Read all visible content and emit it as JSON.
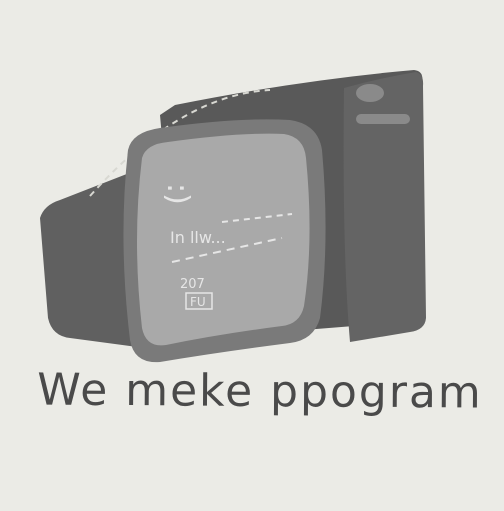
{
  "caption": "We meke ppogram",
  "screen": {
    "smiley": ":)",
    "icon_name": "smiley-face",
    "scribble_text": "In llw...",
    "small_note": "207",
    "boxed_label": "FU"
  },
  "colors": {
    "background": "#ebebe6",
    "monitor_body_dark": "#5a5a5a",
    "monitor_back_dark": "#4f4f4f",
    "monitor_side": "#666666",
    "screen_bezel": "#7a7a7a",
    "screen": "#a9a9a9",
    "caption": "#4a4a4a"
  }
}
